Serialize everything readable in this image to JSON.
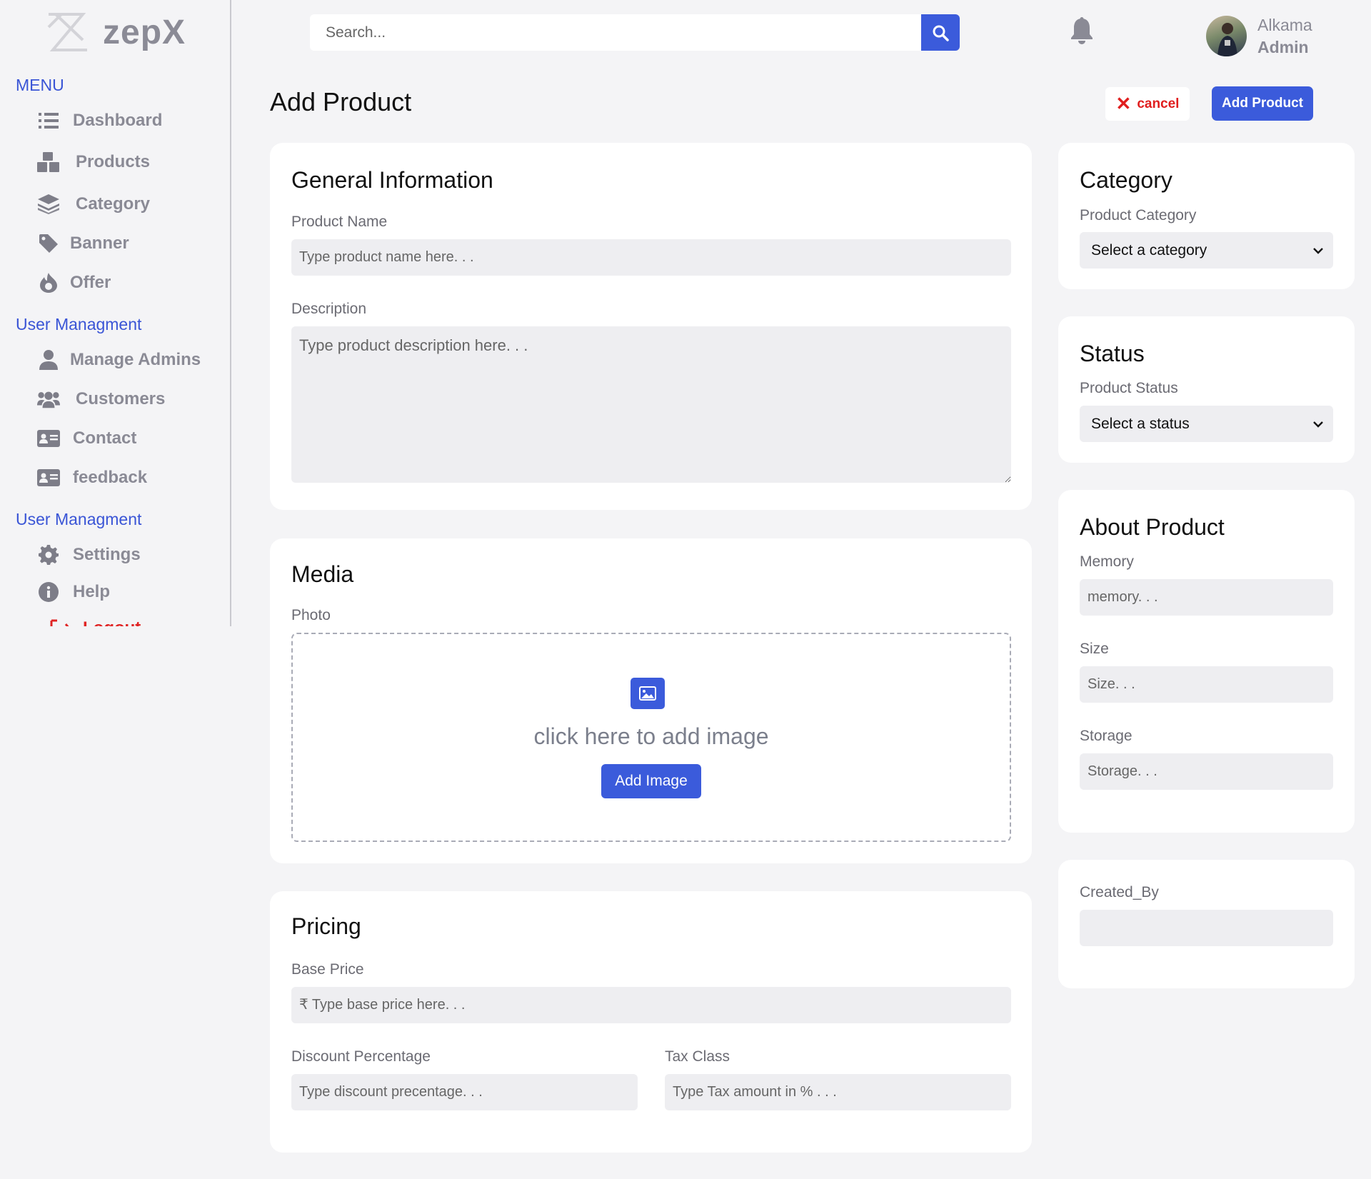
{
  "app": {
    "logo_text": "zepX"
  },
  "sidebar": {
    "menu_heading": "MENU",
    "menu_items": [
      {
        "label": "Dashboard",
        "icon": "list-icon"
      },
      {
        "label": "Products",
        "icon": "boxes-icon"
      },
      {
        "label": "Category",
        "icon": "layers-icon"
      },
      {
        "label": "Banner",
        "icon": "tag-icon"
      },
      {
        "label": "Offer",
        "icon": "fire-icon"
      }
    ],
    "section2_heading": "User Managment",
    "user_items": [
      {
        "label": "Manage Admins",
        "icon": "user-tie-icon"
      },
      {
        "label": "Customers",
        "icon": "users-icon"
      },
      {
        "label": "Contact",
        "icon": "id-card-icon"
      },
      {
        "label": "feedback",
        "icon": "id-card-icon"
      }
    ],
    "section3_heading": "User Managment",
    "settings_items": [
      {
        "label": "Settings",
        "icon": "gear-icon"
      },
      {
        "label": "Help",
        "icon": "info-icon"
      }
    ],
    "logout_label": "Logout"
  },
  "header": {
    "search_placeholder": "Search...",
    "user_name": "Alkama",
    "user_role": "Admin"
  },
  "page": {
    "title": "Add Product",
    "cancel_label": "cancel",
    "add_label": "Add Product"
  },
  "general": {
    "title": "General Information",
    "name_label": "Product Name",
    "name_placeholder": "Type product name here. . .",
    "desc_label": "Description",
    "desc_placeholder": "Type product description here. . ."
  },
  "media": {
    "title": "Media",
    "photo_label": "Photo",
    "drop_text": "click here to add image",
    "add_image_label": "Add Image"
  },
  "pricing": {
    "title": "Pricing",
    "base_label": "Base Price",
    "base_placeholder": "₹ Type base price here. . .",
    "discount_label": "Discount Percentage",
    "discount_placeholder": "Type discount precentage. . .",
    "tax_label": "Tax Class",
    "tax_placeholder": "Type Tax amount in % . . ."
  },
  "category": {
    "title": "Category",
    "label": "Product Category",
    "selected": "Select a category"
  },
  "status": {
    "title": "Status",
    "label": "Product Status",
    "selected": "Select a status"
  },
  "about": {
    "title": "About Product",
    "memory_label": "Memory",
    "memory_placeholder": "memory. . .",
    "size_label": "Size",
    "size_placeholder": "Size. . .",
    "storage_label": "Storage",
    "storage_placeholder": "Storage. . ."
  },
  "created": {
    "label": "Created_By",
    "value": ""
  }
}
